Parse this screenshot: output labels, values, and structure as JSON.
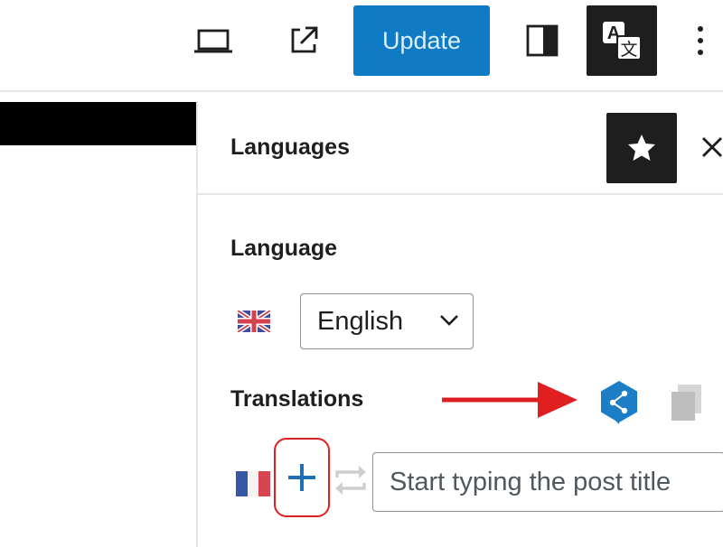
{
  "toolbar": {
    "update_label": "Update",
    "icons": [
      "desktop-preview-icon",
      "external-link-icon",
      "sidebar-toggle-icon",
      "translate-icon",
      "more-vertical-icon"
    ]
  },
  "sidebar": {
    "title": "Languages",
    "header_icons": [
      "star-icon",
      "close-icon"
    ],
    "language": {
      "heading": "Language",
      "flag": "uk-flag-icon",
      "selected": "English"
    },
    "translations": {
      "heading": "Translations",
      "action_icons": [
        "deepl-icon",
        "copy-icon"
      ],
      "rows": [
        {
          "flag": "french-flag-icon",
          "add_icon": "plus-icon",
          "sync_icon": "sync-icon",
          "input_placeholder": "Start typing the post title"
        }
      ]
    }
  },
  "colors": {
    "accent": "#0f7bc5",
    "dark": "#1e1e1e",
    "annotation": "#e02020"
  }
}
